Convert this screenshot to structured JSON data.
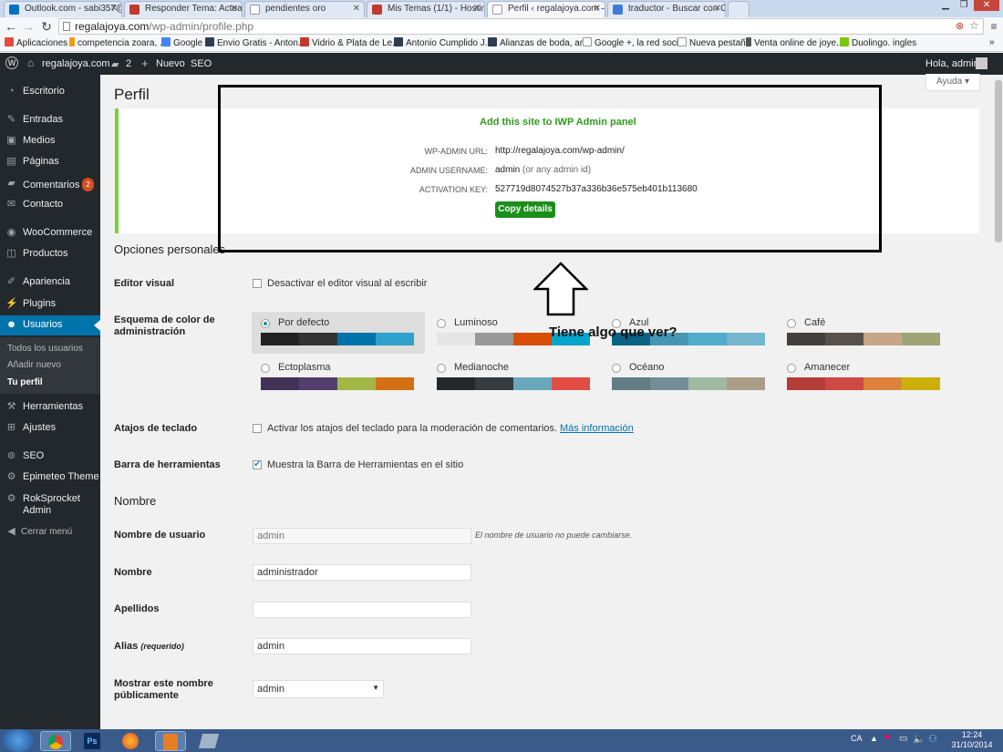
{
  "browser": {
    "tabs": [
      {
        "label": "Outlook.com - sabi357@h",
        "color": "#0072c6"
      },
      {
        "label": "Responder Tema: Actualiz",
        "color": "#c0392b"
      },
      {
        "label": "pendientes oro",
        "color": "#7f8c8d"
      },
      {
        "label": "Mis Temas (1/1) - Hosting",
        "color": "#c0392b"
      },
      {
        "label": "Perfil ‹ regalajoya.com —",
        "color": "#7f8c8d"
      },
      {
        "label": "traductor - Buscar con Go",
        "color": "#3b7dd8"
      }
    ],
    "url_host": "regalajoya.com",
    "url_path": "/wp-admin/profile.php",
    "bookmarks": [
      {
        "label": "Aplicaciones",
        "color": "#e74c3c"
      },
      {
        "label": "competencia zoara, ...",
        "color": "#f39c12"
      },
      {
        "label": "Google",
        "color": "#4285f4"
      },
      {
        "label": "Envio Gratis - Anton...",
        "color": "#2c3e50"
      },
      {
        "label": "Vidrio & Plata de Le...",
        "color": "#c0392b"
      },
      {
        "label": "Antonio Cumplido J...",
        "color": "#2c3e50"
      },
      {
        "label": "Alianzas de boda, an...",
        "color": "#2c3e50"
      },
      {
        "label": "Google +, la red soci...",
        "color": "#999999"
      },
      {
        "label": "Nueva pestaña",
        "color": "#999999"
      },
      {
        "label": "Venta online de joye...",
        "color": "#555555"
      },
      {
        "label": "Duolingo. ingles",
        "color": "#7ac70c"
      }
    ]
  },
  "adminbar": {
    "site": "regalajoya.com",
    "comments_count": "2",
    "new_label": "Nuevo",
    "seo_label": "SEO",
    "greeting": "Hola, admin"
  },
  "sidebar": {
    "items": [
      {
        "label": "Escritorio",
        "icon": "dashboard-icon"
      },
      {
        "label": "Entradas",
        "icon": "pin-icon"
      },
      {
        "label": "Medios",
        "icon": "media-icon"
      },
      {
        "label": "Páginas",
        "icon": "page-icon"
      },
      {
        "label": "Comentarios",
        "icon": "comment-icon",
        "badge": "2"
      },
      {
        "label": "Contacto",
        "icon": "mail-icon"
      },
      {
        "label": "WooCommerce",
        "icon": "woo-icon"
      },
      {
        "label": "Productos",
        "icon": "product-icon"
      },
      {
        "label": "Apariencia",
        "icon": "brush-icon"
      },
      {
        "label": "Plugins",
        "icon": "plugin-icon"
      },
      {
        "label": "Usuarios",
        "icon": "users-icon"
      },
      {
        "label": "Herramientas",
        "icon": "tools-icon"
      },
      {
        "label": "Ajustes",
        "icon": "settings-icon"
      },
      {
        "label": "SEO",
        "icon": "seo-icon"
      },
      {
        "label": "Epimeteo Theme",
        "icon": "gear-icon"
      },
      {
        "label": "RokSprocket Admin",
        "icon": "gear-icon"
      },
      {
        "label": "Cerrar menú",
        "icon": "collapse-icon"
      }
    ],
    "user_sub": [
      "Todos los usuarios",
      "Añadir nuevo",
      "Tu perfil"
    ]
  },
  "page": {
    "title": "Perfil",
    "help": "Ayuda",
    "iwp": {
      "heading": "Add this site to IWP Admin panel",
      "url_label": "WP-ADMIN URL:",
      "url_value": "http://regalajoya.com/wp-admin/",
      "user_label": "ADMIN USERNAME:",
      "user_value": "admin",
      "user_note": "(or any admin id)",
      "key_label": "ACTIVATION KEY:",
      "key_value": "527719d8074527b37a336b36e575eb401b113680",
      "copy_button": "Copy details"
    },
    "annotation": "Tiene algo que ver?",
    "personal_heading": "Opciones personales",
    "visual_editor_label": "Editor visual",
    "visual_editor_text": "Desactivar el editor visual al escribir",
    "color_scheme_label": "Esquema de color de administración",
    "schemes": [
      {
        "name": "Por defecto",
        "selected": true,
        "colors": [
          "#222222",
          "#333333",
          "#0073aa",
          "#2ea2cc"
        ]
      },
      {
        "name": "Luminoso",
        "selected": false,
        "colors": [
          "#e5e5e5",
          "#999999",
          "#d64e07",
          "#04a4cc"
        ]
      },
      {
        "name": "Azul",
        "selected": false,
        "colors": [
          "#096484",
          "#4796b3",
          "#52accc",
          "#74b6ce"
        ]
      },
      {
        "name": "Café",
        "selected": false,
        "colors": [
          "#46403c",
          "#59524c",
          "#c7a589",
          "#9ea476"
        ]
      },
      {
        "name": "Ectoplasma",
        "selected": false,
        "colors": [
          "#413256",
          "#523f6d",
          "#a3b745",
          "#d46f15"
        ]
      },
      {
        "name": "Medianoche",
        "selected": false,
        "colors": [
          "#25282b",
          "#363b3f",
          "#69a8bb",
          "#e14d43"
        ]
      },
      {
        "name": "Océano",
        "selected": false,
        "colors": [
          "#627c83",
          "#738e96",
          "#9ebaa0",
          "#aa9d88"
        ]
      },
      {
        "name": "Amanecer",
        "selected": false,
        "colors": [
          "#b43c38",
          "#cf4944",
          "#dd823b",
          "#ccaf0b"
        ]
      }
    ],
    "shortcuts_label": "Atajos de teclado",
    "shortcuts_text": "Activar los atajos del teclado para la moderación de comentarios.",
    "shortcuts_link": "Más información",
    "toolbar_label": "Barra de herramientas",
    "toolbar_text": "Muestra la Barra de Herramientas en el sitio",
    "name_heading": "Nombre",
    "username_label": "Nombre de usuario",
    "username_placeholder": "admin",
    "username_note": "El nombre de usuario no puede cambiarse.",
    "first_name_label": "Nombre",
    "first_name_value": "administrador",
    "last_name_label": "Apellidos",
    "last_name_value": "",
    "nickname_label": "Alias",
    "nickname_required": "(requerido)",
    "nickname_value": "admin",
    "display_label": "Mostrar este nombre públicamente",
    "display_value": "admin"
  },
  "taskbar": {
    "lang": "CA",
    "time": "12:24",
    "date": "31/10/2014"
  }
}
